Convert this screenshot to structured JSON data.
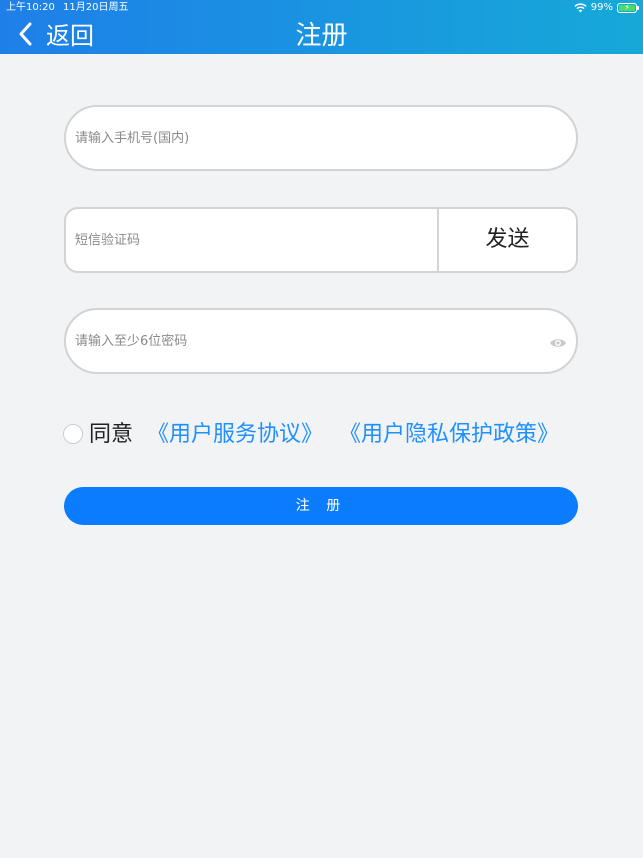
{
  "status_bar": {
    "time": "上午10:20",
    "date": "11月20日周五",
    "battery": "99%",
    "battery_level": 0.99,
    "icons": [
      "wifi-icon",
      "battery-icon"
    ]
  },
  "nav": {
    "back_label": "返回",
    "back_icon": "chevron-left-icon",
    "title": "注册"
  },
  "form": {
    "phone": {
      "value": "",
      "placeholder": "请输入手机号(国内)"
    },
    "sms_code": {
      "value": "",
      "placeholder": "短信验证码",
      "send_label": "发送"
    },
    "password": {
      "value": "",
      "placeholder": "请输入至少6位密码",
      "visibility_icon": "eye-icon"
    },
    "agreement": {
      "checked": false,
      "label": "同意",
      "terms_link": "《用户服务协议》",
      "privacy_link": "《用户隐私保护政策》"
    },
    "submit_label": "注 册"
  },
  "colors": {
    "nav_gradient_start": "#1e7fe9",
    "nav_gradient_end": "#16a9d8",
    "background": "#f2f3f5",
    "primary_button": "#0c7cff",
    "link": "#1e90ff",
    "field_border": "#d3d3d3"
  }
}
